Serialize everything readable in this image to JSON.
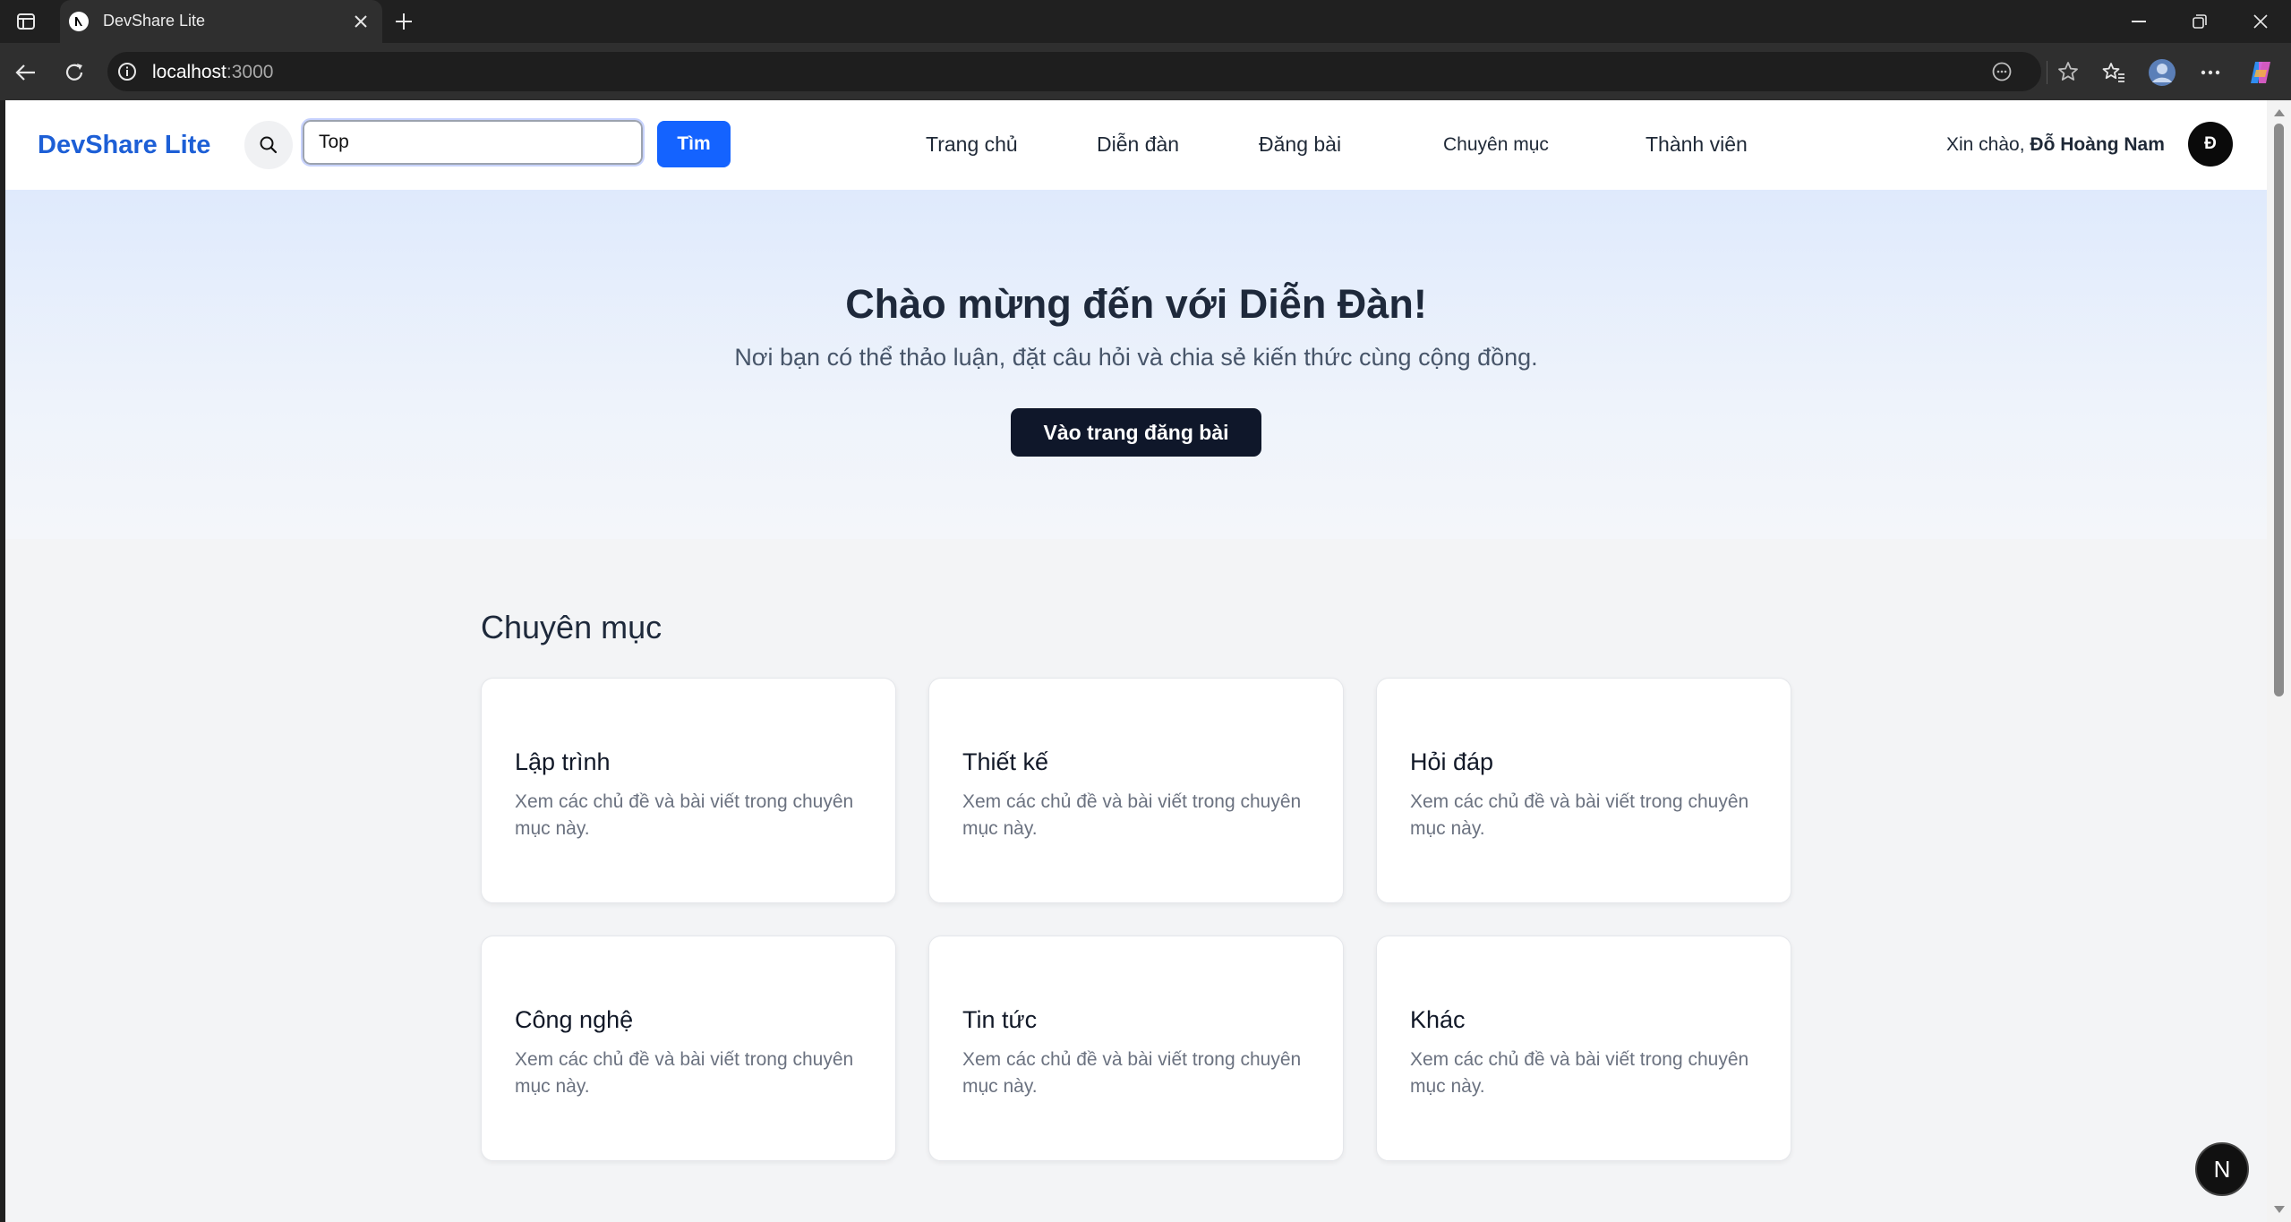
{
  "browser": {
    "tab_title": "DevShare Lite",
    "url_host": "localhost",
    "url_port": ":3000"
  },
  "header": {
    "logo": "DevShare Lite",
    "search_value": "Top",
    "search_button": "Tìm",
    "nav": [
      "Trang chủ",
      "Diễn đàn",
      "Đăng bài",
      "Chuyên mục",
      "Thành viên"
    ],
    "greeting_prefix": "Xin chào, ",
    "user_name": "Đỗ Hoàng Nam",
    "avatar_initial": "Đ"
  },
  "hero": {
    "title": "Chào mừng đến với Diễn Đàn!",
    "subtitle": "Nơi bạn có thể thảo luận, đặt câu hỏi và chia sẻ kiến thức cùng cộng đồng.",
    "cta": "Vào trang đăng bài"
  },
  "categories": {
    "title": "Chuyên mục",
    "items": [
      {
        "title": "Lập trình",
        "desc": "Xem các chủ đề và bài viết trong chuyên mục này."
      },
      {
        "title": "Thiết kế",
        "desc": "Xem các chủ đề và bài viết trong chuyên mục này."
      },
      {
        "title": "Hỏi đáp",
        "desc": "Xem các chủ đề và bài viết trong chuyên mục này."
      },
      {
        "title": "Công nghệ",
        "desc": "Xem các chủ đề và bài viết trong chuyên mục này."
      },
      {
        "title": "Tin tức",
        "desc": "Xem các chủ đề và bài viết trong chuyên mục này."
      },
      {
        "title": "Khác",
        "desc": "Xem các chủ đề và bài viết trong chuyên mục này."
      }
    ]
  },
  "nextjs_badge": "N",
  "colors": {
    "brand": "#1d5fd6",
    "primary_button": "#1463ff",
    "dark_button": "#0f172a"
  }
}
